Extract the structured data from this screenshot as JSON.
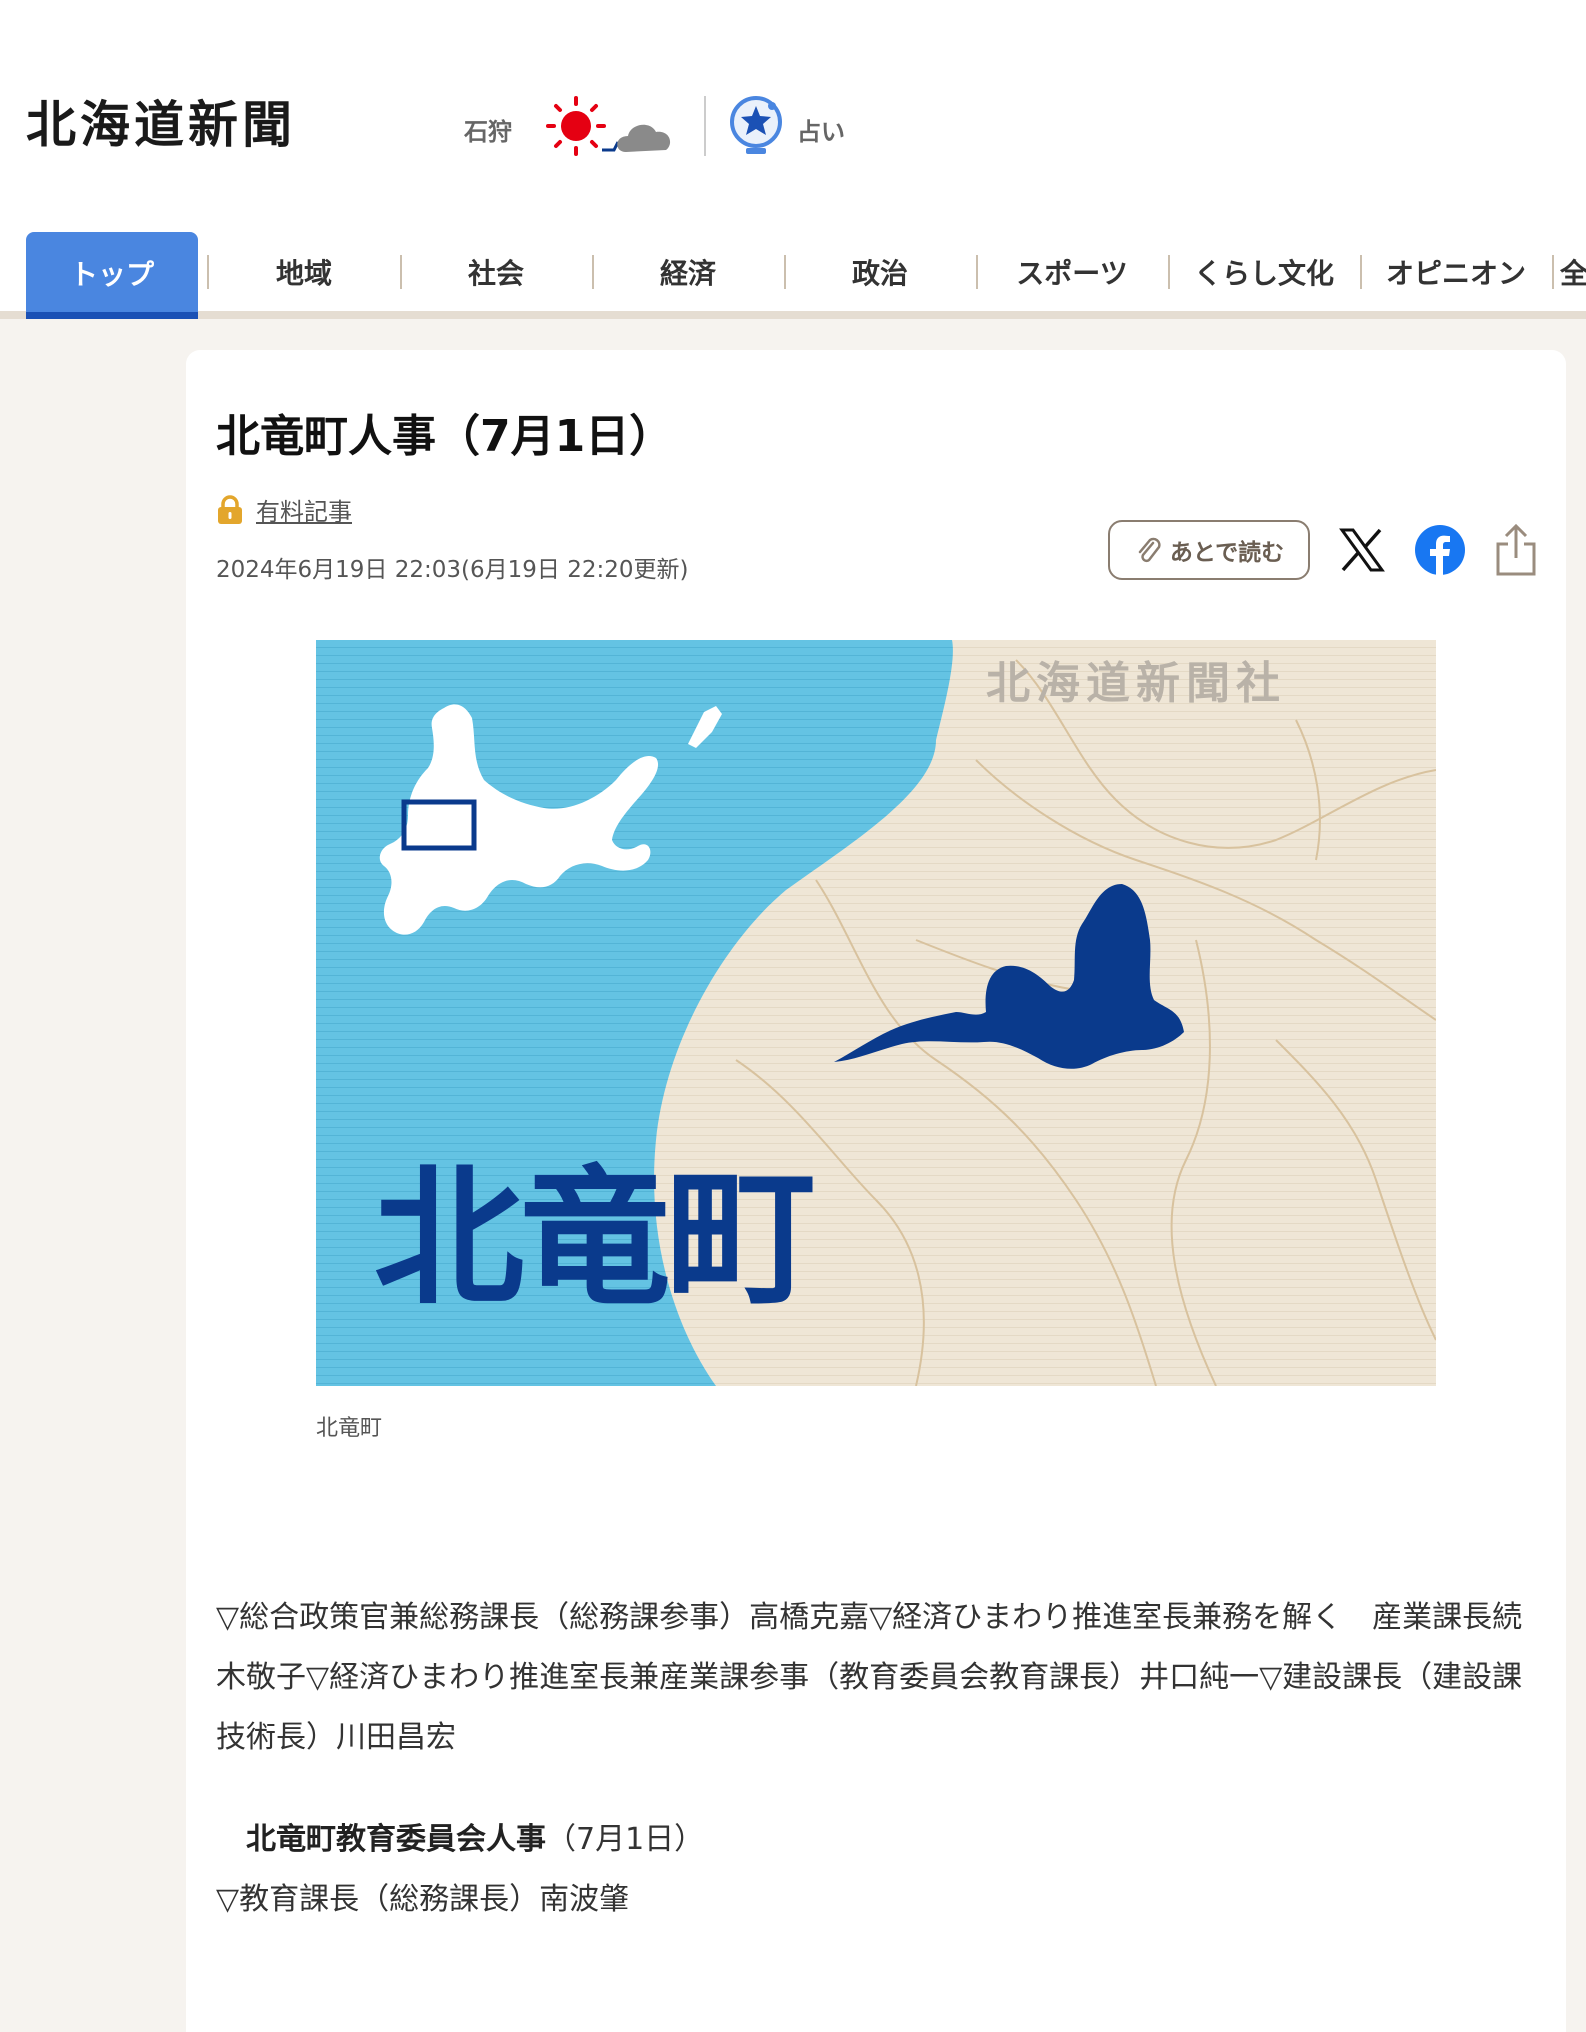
{
  "header": {
    "logo": "北海道新聞",
    "weather": {
      "region": "石狩",
      "icons": [
        "sun-icon",
        "cloud-icon"
      ]
    },
    "fortune": {
      "label": "占い",
      "icon": "fortune-icon"
    }
  },
  "nav": {
    "tabs": [
      {
        "label": "トップ",
        "active": true
      },
      {
        "label": "地域"
      },
      {
        "label": "社会"
      },
      {
        "label": "経済"
      },
      {
        "label": "政治"
      },
      {
        "label": "スポーツ"
      },
      {
        "label": "くらし文化"
      },
      {
        "label": "オピニオン"
      },
      {
        "label": "全"
      }
    ]
  },
  "article": {
    "title": "北竜町人事（7月1日）",
    "paid_label": "有料記事",
    "date": "2024年6月19日 22:03(6月19日 22:20更新)",
    "actions": {
      "read_later": "あとで読む",
      "share_icons": [
        "x-icon",
        "facebook-icon",
        "share-icon"
      ]
    },
    "figure": {
      "map_title": "北竜町",
      "watermark": "北海道新聞社",
      "caption": "北竜町"
    },
    "body": "▽総合政策官兼総務課長（総務課参事）高橋克嘉▽経済ひまわり推進室長兼務を解く　産業課長続木敬子▽経済ひまわり推進室長兼産業課参事（教育委員会教育課長）井口純一▽建設課長（建設課技術長）川田昌宏",
    "sub_heading_bold": "北竜町教育委員会人事",
    "sub_heading_rest": "（7月1日）",
    "body2": "▽教育課長（総務課長）南波肇"
  },
  "colors": {
    "accent": "#4a86e0",
    "accent_dark": "#1b51b5",
    "map_sea": "#64c3e3",
    "map_land": "#efe6d6",
    "map_town": "#0a3a8c",
    "page_bg": "#f6f3ef"
  }
}
